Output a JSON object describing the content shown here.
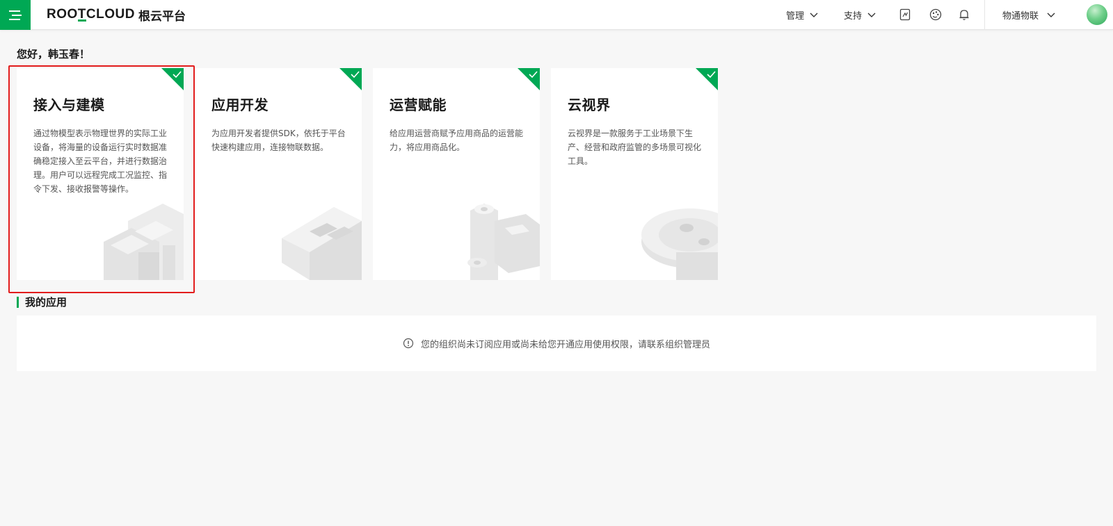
{
  "header": {
    "logo_en_pre": "ROO",
    "logo_en_mid": "T",
    "logo_en_post": "CLOUD",
    "logo_cn": "根云平台",
    "nav": {
      "manage_label": "管理",
      "support_label": "支持",
      "workspace_label": "物通物联"
    },
    "accent_color": "#00a854"
  },
  "greeting": "您好，韩玉春！",
  "cards": [
    {
      "title": "接入与建模",
      "desc": "通过物模型表示物理世界的实际工业设备，将海量的设备运行实时数据准确稳定接入至云平台，并进行数据治理。用户可以远程完成工况监控、指令下发、接收报警等操作。",
      "checked": true
    },
    {
      "title": "应用开发",
      "desc": "为应用开发者提供SDK，依托于平台快速构建应用，连接物联数据。",
      "checked": true
    },
    {
      "title": "运营赋能",
      "desc": "给应用运营商赋予应用商品的运营能力，将应用商品化。",
      "checked": true
    },
    {
      "title": "云视界",
      "desc": "云视界是一款服务于工业场景下生产、经营和政府监管的多场景可视化工具。",
      "checked": true
    }
  ],
  "my_apps": {
    "title": "我的应用",
    "empty_message": "您的组织尚未订阅应用或尚未给您开通应用使用权限，请联系组织管理员"
  }
}
